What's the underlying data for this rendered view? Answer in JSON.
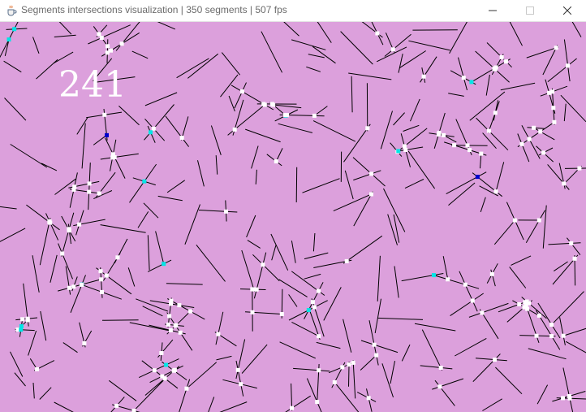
{
  "window": {
    "title": "Segments intersections visualization | 350 segments | 507 fps",
    "app_icon": "java-coffee-icon",
    "controls": {
      "minimize_icon": "minimize-icon",
      "maximize_icon": "maximize-icon",
      "close_icon": "close-icon"
    }
  },
  "visualization": {
    "background_color": "#dca0dc",
    "segment_color": "#000000",
    "intersection_color": "#ffffff",
    "highlight_color": "#00e5e5",
    "selected_color": "#0000cc",
    "intersection_count": "241"
  }
}
